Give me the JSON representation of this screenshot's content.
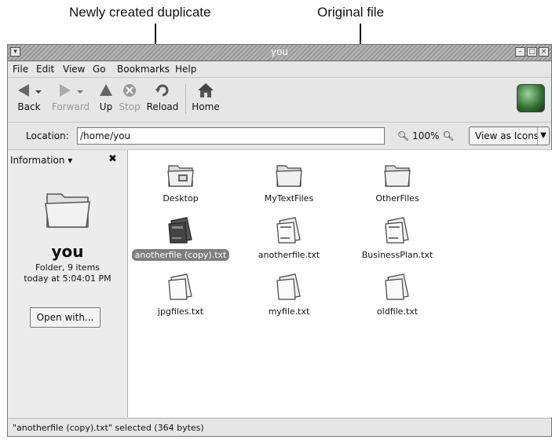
{
  "callouts": {
    "left": "Newly created duplicate",
    "right": "Original file"
  },
  "window": {
    "title": "you"
  },
  "menu": [
    "File",
    "Edit",
    "View",
    "Go",
    "Bookmarks",
    "Help"
  ],
  "toolbar": {
    "back": "Back",
    "forward": "Forward",
    "up": "Up",
    "stop": "Stop",
    "reload": "Reload",
    "home": "Home"
  },
  "location": {
    "label": "Location:",
    "value": "/home/you",
    "zoom": "100%",
    "view_mode": "View as Icons"
  },
  "sidebar": {
    "header": "Information",
    "name": "you",
    "kind": "Folder, 9 items",
    "modified": "today at 5:04:01 PM",
    "open_with": "Open with..."
  },
  "files": [
    {
      "name": "Desktop",
      "type": "folder"
    },
    {
      "name": "MyTextFiles",
      "type": "folder"
    },
    {
      "name": "OtherFiles",
      "type": "folder"
    },
    {
      "name": "anotherfile (copy).txt",
      "type": "text",
      "selected": true
    },
    {
      "name": "anotherfile.txt",
      "type": "text"
    },
    {
      "name": "BusinessPlan.txt",
      "type": "text"
    },
    {
      "name": "jpgfiles.txt",
      "type": "blank"
    },
    {
      "name": "myfile.txt",
      "type": "blank"
    },
    {
      "name": "oldfile.txt",
      "type": "blank"
    }
  ],
  "status": "\"anotherfile (copy).txt\" selected (364 bytes)"
}
